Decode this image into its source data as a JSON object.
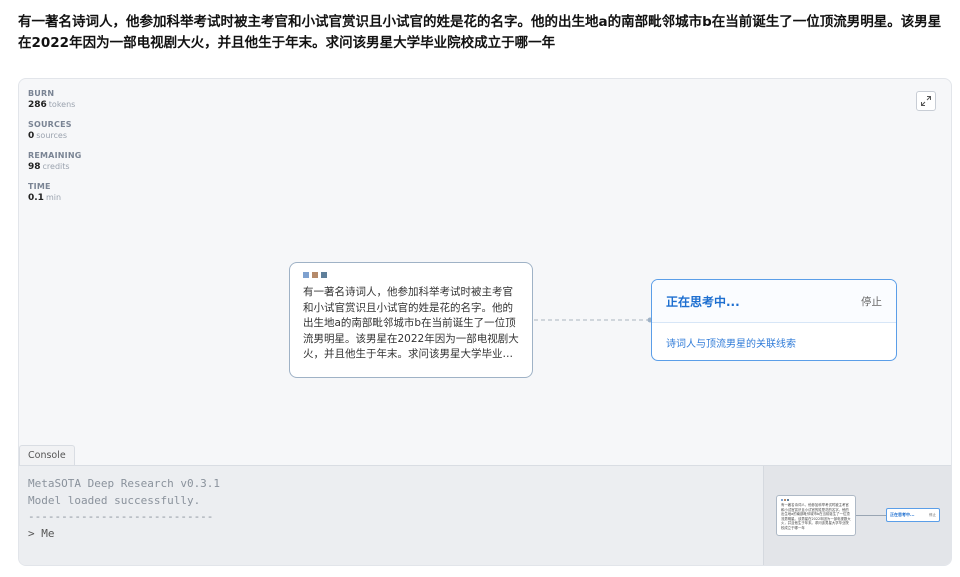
{
  "question": "有一著名诗词人，他参加科举考试时被主考官和小试官赏识且小试官的姓是花的名字。他的出生地a的南部毗邻城市b在当前诞生了一位顶流男明星。该男星在2022年因为一部电视剧大火，并且他生于年末。求问该男星大学毕业院校成立于哪一年",
  "stats": [
    {
      "label": "BURN",
      "value": "286",
      "unit": "tokens"
    },
    {
      "label": "SOURCES",
      "value": "0",
      "unit": "sources"
    },
    {
      "label": "REMAINING",
      "value": "98",
      "unit": "credits"
    },
    {
      "label": "TIME",
      "value": "0.1",
      "unit": "min"
    }
  ],
  "query_node": {
    "dots": [
      "#7ea1cf",
      "#b58a6a",
      "#5f7f9a"
    ],
    "text": "有一著名诗词人，他参加科举考试时被主考官和小试官赏识且小试官的姓是花的名字。他的出生地a的南部毗邻城市b在当前诞生了一位顶流男明星。该男星在2022年因为一部电视剧大火，并且他生于年末。求问该男星大学毕业院校成立于哪一年"
  },
  "thinking_node": {
    "title": "正在思考中...",
    "stop_label": "停止",
    "item": "诗词人与顶流男星的关联线索"
  },
  "console": {
    "tab_label": "Console",
    "lines": [
      "MetaSOTA Deep Research v0.3.1",
      "Model loaded successfully.",
      "----------------------------",
      "> Me"
    ]
  },
  "colors": {
    "accent": "#1e6fd0",
    "node_border": "#5b9ee8"
  }
}
